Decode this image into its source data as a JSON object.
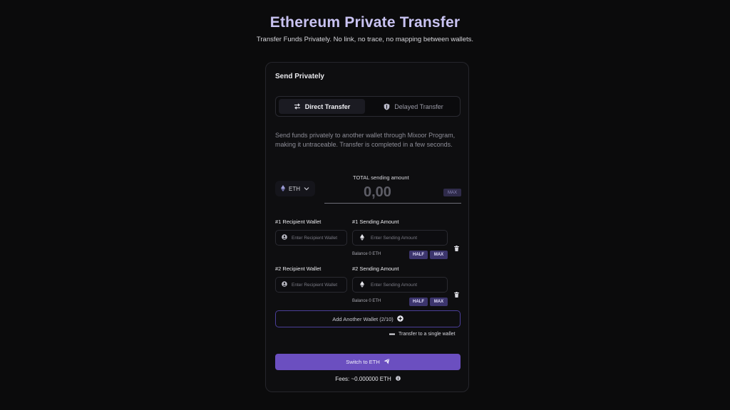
{
  "header": {
    "title": "Ethereum Private Transfer",
    "subtitle": "Transfer Funds Privately. No link, no trace, no mapping between wallets."
  },
  "card": {
    "title": "Send Privately",
    "tabs": [
      {
        "label": "Direct  Transfer",
        "icon": "swap-arrows-icon",
        "active": true
      },
      {
        "label": "Delayed  Transfer",
        "icon": "shield-icon",
        "active": false
      }
    ],
    "description": "Send funds privately to another wallet through Mixoor Program, making it untraceable. Transfer is completed in a few seconds.",
    "token": {
      "symbol": "ETH",
      "icon": "ethereum-icon"
    },
    "total": {
      "label": "TOTAL sending amount",
      "value": "0,00",
      "max_label": "MAX"
    },
    "recipients": [
      {
        "wallet_label": "#1 Recipient Wallet",
        "wallet_placeholder": "Enter Recipient Wallet",
        "amount_label": "#1 Sending Amount",
        "amount_placeholder": "Enter Sending Amount",
        "balance": "Balance 0 ETH",
        "half_label": "HALF",
        "max_label": "MAX"
      },
      {
        "wallet_label": "#2 Recipient Wallet",
        "wallet_placeholder": "Enter Recipient Wallet",
        "amount_label": "#2 Sending Amount",
        "amount_placeholder": "Enter Sending Amount",
        "balance": "Balance 0 ETH",
        "half_label": "HALF",
        "max_label": "MAX"
      }
    ],
    "add_wallet_label": "Add Another Wallet (2/10)",
    "single_wallet_label": "Transfer to a single wallet",
    "switch_button_label": "Switch to ETH",
    "fees_label": "Fees: ~0.000000 ETH"
  },
  "colors": {
    "background": "#0b0b0c",
    "accent": "#6b4fc0",
    "title": "#c9c3f2",
    "chip": "#3c356d"
  }
}
